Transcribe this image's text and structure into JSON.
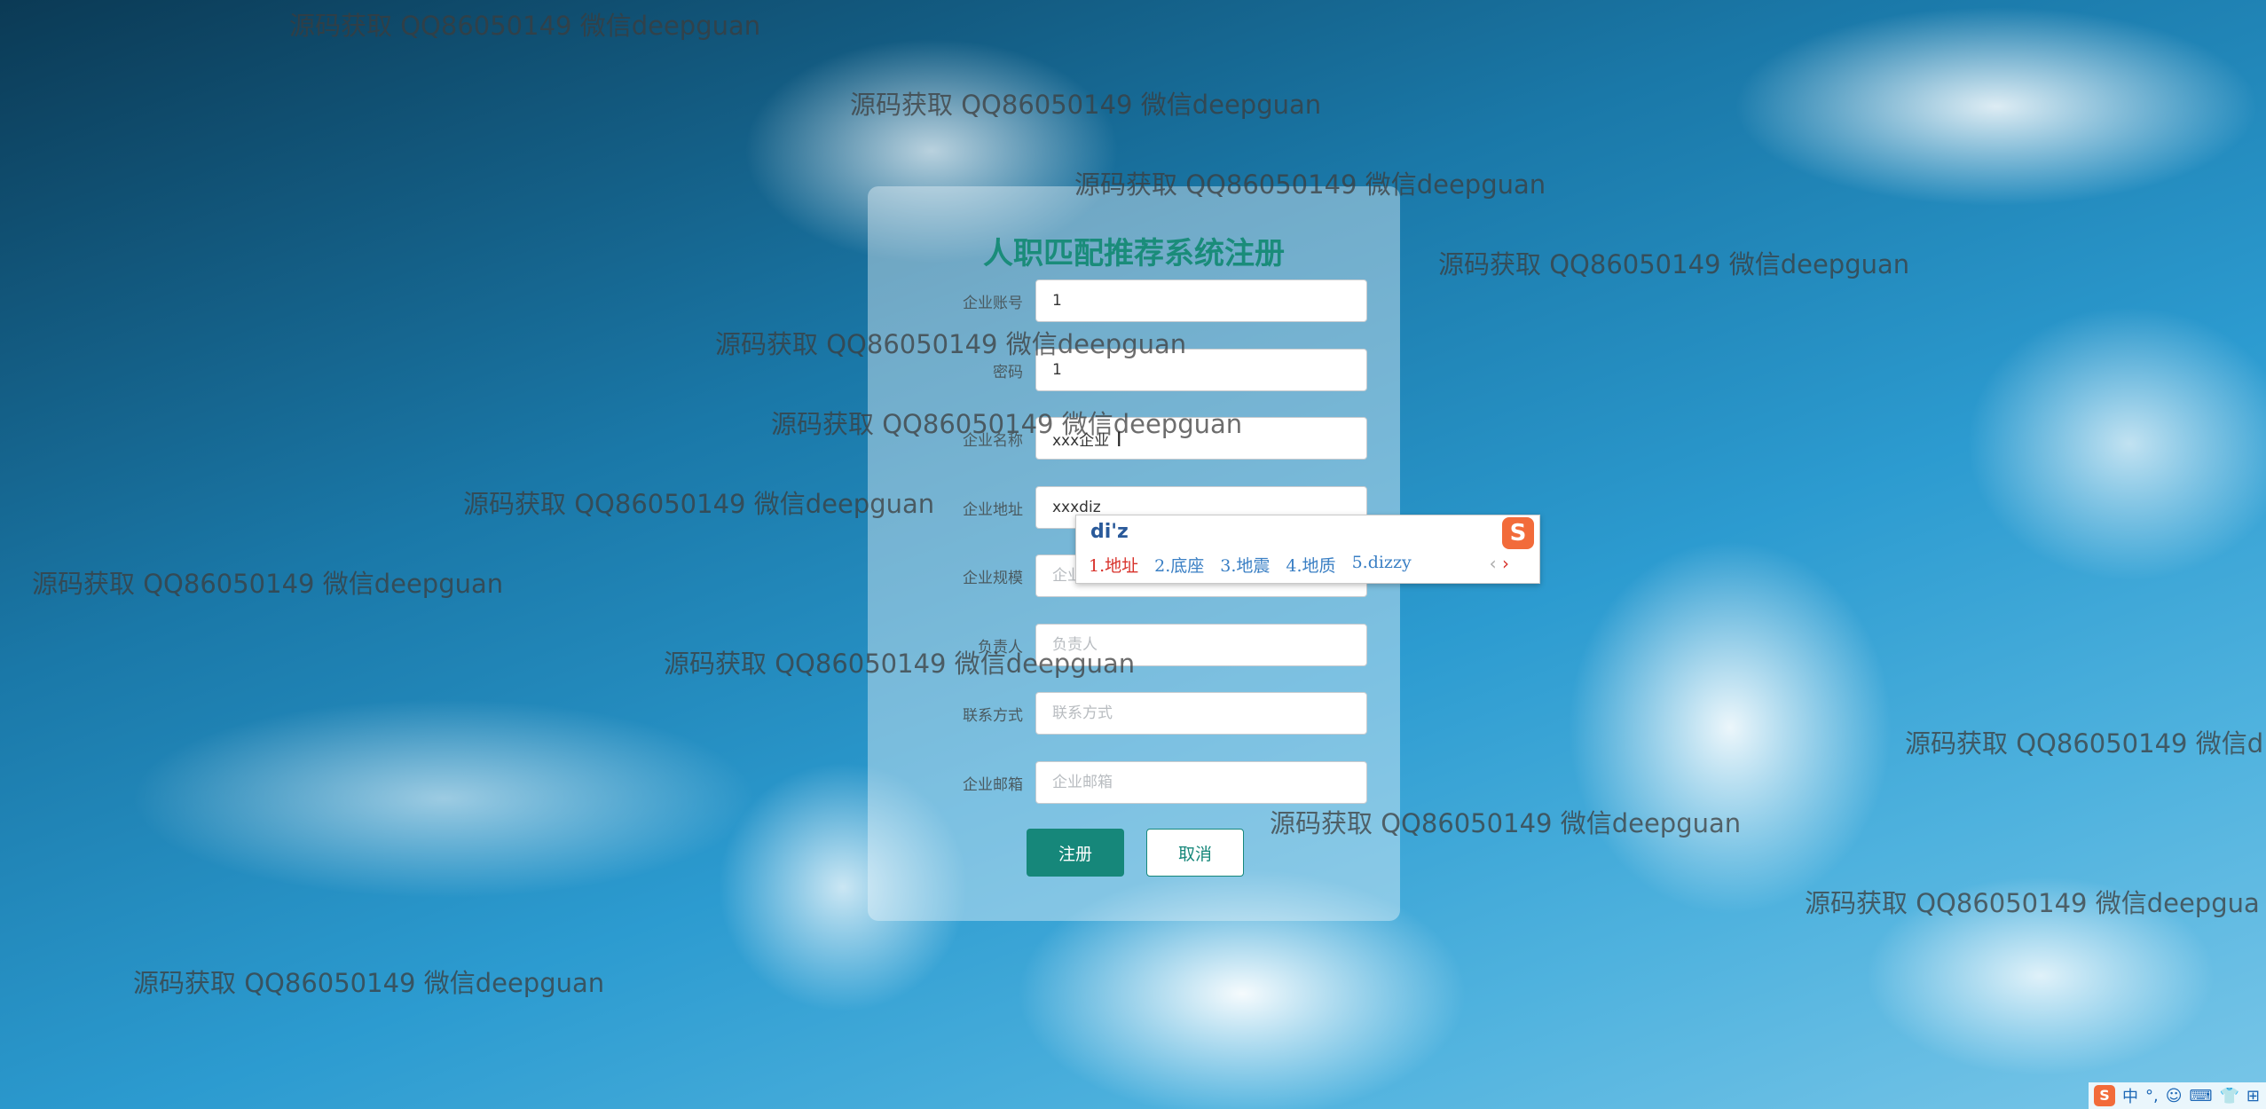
{
  "form": {
    "title": "人职匹配推荐系统注册",
    "fields": [
      {
        "label": "企业账号",
        "value": "1",
        "placeholder": ""
      },
      {
        "label": "密码",
        "value": "1",
        "placeholder": ""
      },
      {
        "label": "企业名称",
        "value": "xxx企业",
        "placeholder": ""
      },
      {
        "label": "企业地址",
        "value": "xxxdiz",
        "placeholder": ""
      },
      {
        "label": "企业规模",
        "value": "",
        "placeholder": "企业规模"
      },
      {
        "label": "负责人",
        "value": "",
        "placeholder": "负责人"
      },
      {
        "label": "联系方式",
        "value": "",
        "placeholder": "联系方式"
      },
      {
        "label": "企业邮箱",
        "value": "",
        "placeholder": "企业邮箱"
      }
    ],
    "register_label": "注册",
    "cancel_label": "取消"
  },
  "ime": {
    "composition": "di'z",
    "candidates": [
      "1.地址",
      "2.底座",
      "3.地震",
      "4.地质",
      "5.dizzy"
    ],
    "logo_text": "S",
    "prev": "‹",
    "next": "›"
  },
  "watermark_text": "源码获取 QQ86050149 微信deepguan",
  "watermark_partial_1": "源码获取 QQ86050149 微信d",
  "watermark_partial_2": "源码获取 QQ86050149 微信deepgua",
  "tray": {
    "logo": "S",
    "lang": "中",
    "icons": [
      "°,",
      "☺",
      "⌨",
      "👕",
      "⊞"
    ]
  }
}
